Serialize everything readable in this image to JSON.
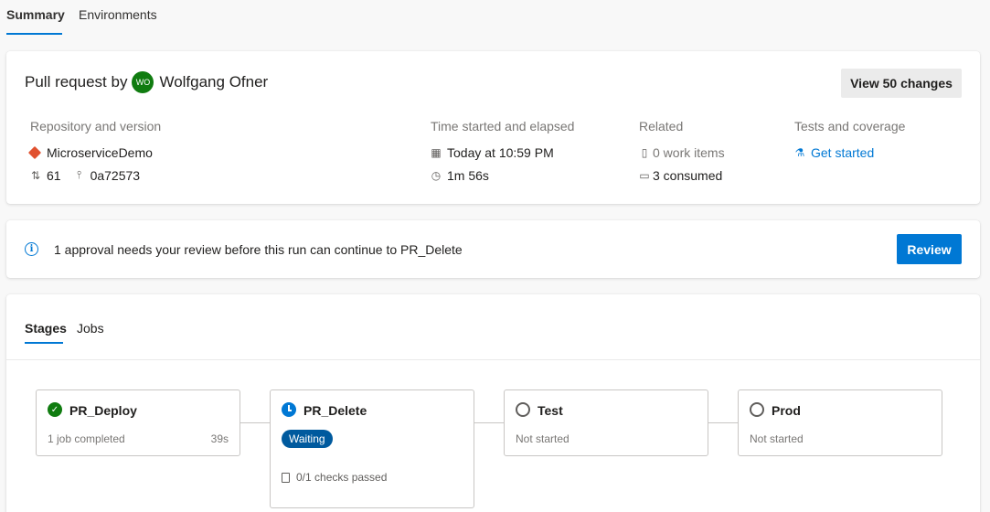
{
  "tabs": {
    "summary": "Summary",
    "environments": "Environments"
  },
  "summary": {
    "title_prefix": "Pull request by",
    "avatar_initials": "WO",
    "author": "Wolfgang Ofner",
    "view_changes": "View 50 changes",
    "repo": {
      "label": "Repository and version",
      "name": "MicroserviceDemo",
      "pr_number": "61",
      "commit": "0a72573"
    },
    "time": {
      "label": "Time started and elapsed",
      "started": "Today at 10:59 PM",
      "elapsed": "1m 56s"
    },
    "related": {
      "label": "Related",
      "work_items": "0 work items",
      "consumed": "3 consumed"
    },
    "tests": {
      "label": "Tests and coverage",
      "link": "Get started"
    }
  },
  "approval": {
    "text": "1 approval needs your review before this run can continue to PR_Delete",
    "button": "Review"
  },
  "stages_panel": {
    "tabs": {
      "stages": "Stages",
      "jobs": "Jobs"
    },
    "stages": [
      {
        "name": "PR_Deploy",
        "status": "1 job completed",
        "duration": "39s",
        "state": "success"
      },
      {
        "name": "PR_Delete",
        "badge": "Waiting",
        "checks": "0/1 checks passed",
        "state": "waiting"
      },
      {
        "name": "Test",
        "status": "Not started",
        "state": "not-started"
      },
      {
        "name": "Prod",
        "status": "Not started",
        "state": "not-started"
      }
    ]
  },
  "colors": {
    "accent": "#0078d4",
    "success": "#107c10",
    "waiting_badge": "#005a9e"
  }
}
